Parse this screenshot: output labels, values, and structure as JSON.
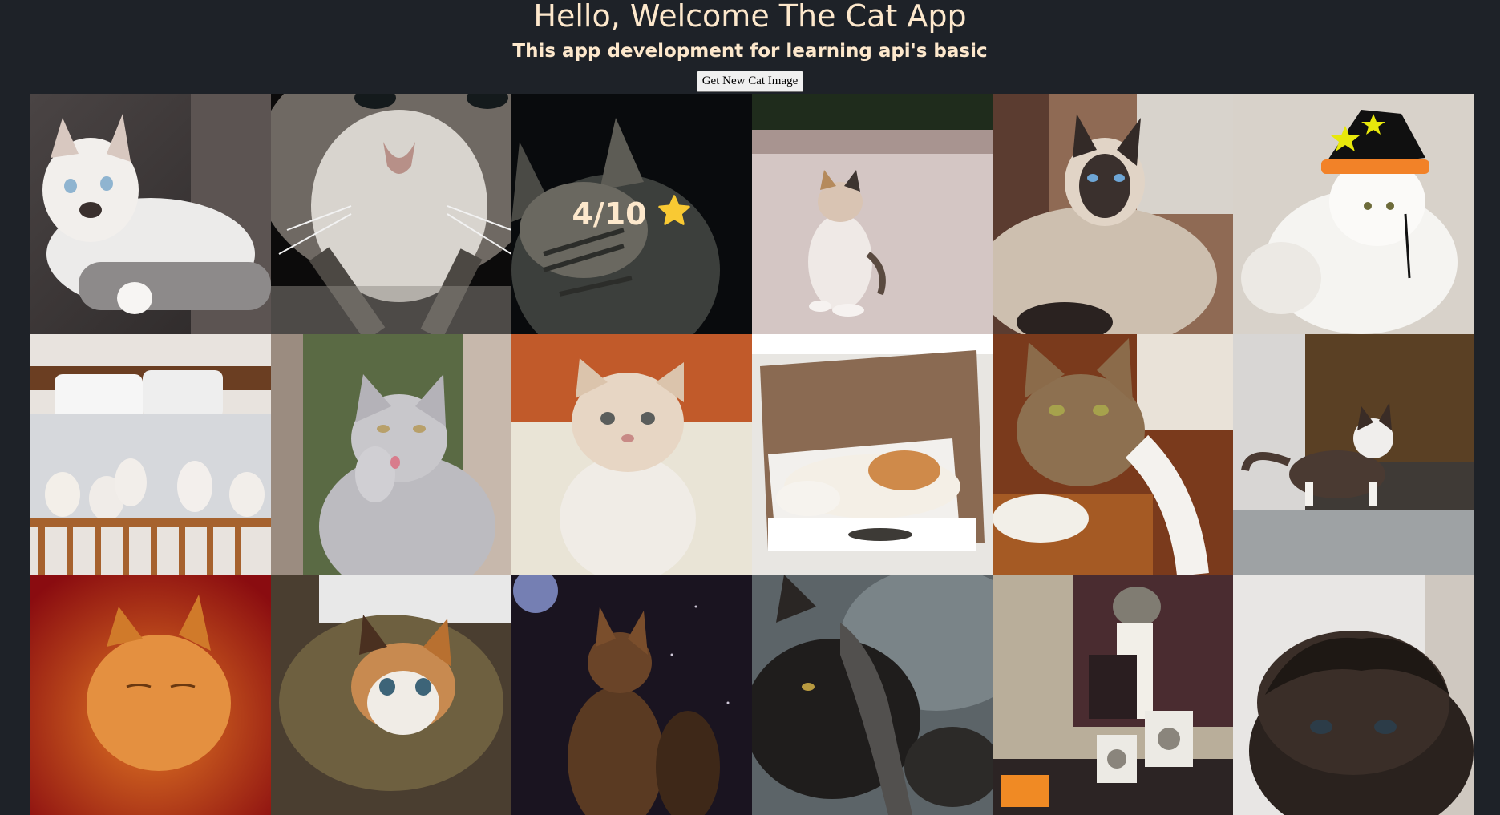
{
  "header": {
    "title": "Hello, Welcome The Cat App",
    "subtitle": "This app development for learning api's basic",
    "button_label": "Get New Cat Image"
  },
  "rating": {
    "text": "4/10",
    "icon": "star-icon",
    "color": "#f9c933"
  },
  "colors": {
    "background": "#1e2228",
    "heading": "#fde8cc"
  },
  "cats": [
    {
      "name": "cat-image-white-kitten"
    },
    {
      "name": "cat-image-tabby-closeup"
    },
    {
      "name": "cat-image-dark-tabby-rated"
    },
    {
      "name": "cat-image-standing-calico"
    },
    {
      "name": "cat-image-siamese-longhair"
    },
    {
      "name": "cat-image-persian-witch-hat"
    },
    {
      "name": "cat-image-kittens-on-bed"
    },
    {
      "name": "cat-image-grey-kitten-licking"
    },
    {
      "name": "cat-image-exotic-kitten"
    },
    {
      "name": "cat-image-cat-in-box"
    },
    {
      "name": "cat-image-calico-on-chair"
    },
    {
      "name": "cat-image-munchkin-on-table"
    },
    {
      "name": "cat-image-orange-kitten"
    },
    {
      "name": "cat-image-calico-kitten-basket"
    },
    {
      "name": "cat-image-silhouette-night"
    },
    {
      "name": "cat-image-black-cat-lap"
    },
    {
      "name": "cat-image-cat-on-speakers"
    },
    {
      "name": "cat-image-cat-wig"
    }
  ]
}
